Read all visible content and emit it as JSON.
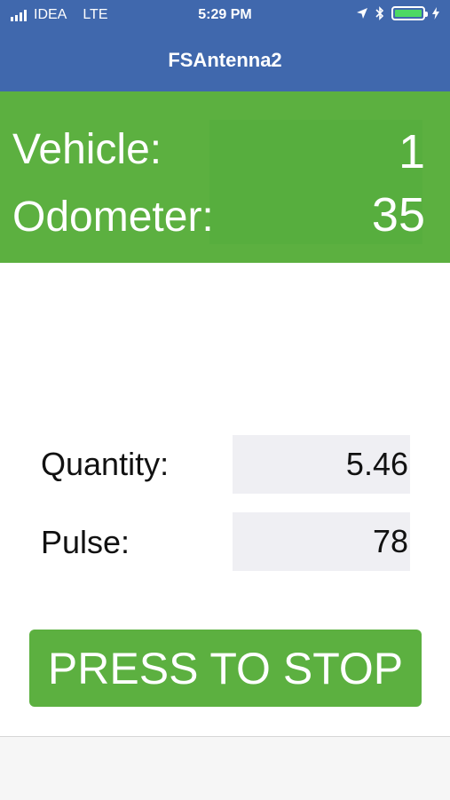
{
  "status_bar": {
    "carrier": "IDEA",
    "network": "LTE",
    "time": "5:29 PM",
    "icons": [
      "signal-bars-icon",
      "location-arrow-icon",
      "bluetooth-icon",
      "battery-icon",
      "charging-bolt-icon"
    ]
  },
  "nav": {
    "title": "FSAntenna2"
  },
  "vehicle_panel": {
    "vehicle_label": "Vehicle:",
    "vehicle_value": "1",
    "odometer_label": "Odometer:",
    "odometer_value": "35"
  },
  "readings": {
    "quantity_label": "Quantity:",
    "quantity_value": "5.46",
    "pulse_label": "Pulse:",
    "pulse_value": "78"
  },
  "actions": {
    "stop_label": "PRESS TO STOP"
  },
  "colors": {
    "nav_bar": "#4068ad",
    "accent_green": "#5cb040",
    "field_bg": "#efeff3"
  }
}
